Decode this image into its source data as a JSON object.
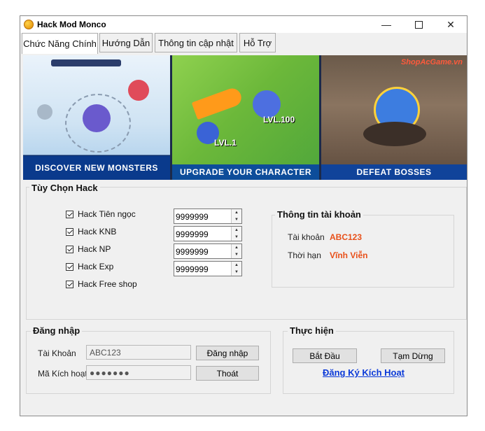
{
  "window": {
    "title": "Hack Mod Monco"
  },
  "tabs": [
    {
      "label": "Chức Năng Chính"
    },
    {
      "label": "Hướng Dẫn"
    },
    {
      "label": "Thông tin cập nhật"
    },
    {
      "label": "Hỗ Trợ"
    }
  ],
  "banner": {
    "captions": [
      "DISCOVER NEW MONSTERS",
      "UPGRADE YOUR CHARACTER",
      "DEFEAT BOSSES"
    ],
    "level_before": "LVL.1",
    "level_after": "LVL.100",
    "watermark": "ShopAcGame.vn"
  },
  "hack_options": {
    "title": "Tùy Chọn Hack",
    "items": [
      {
        "label": "Hack Tiên ngọc",
        "checked": true,
        "value": "9999999"
      },
      {
        "label": "Hack KNB",
        "checked": true,
        "value": "9999999"
      },
      {
        "label": "Hack NP",
        "checked": true,
        "value": "9999999"
      },
      {
        "label": "Hack Exp",
        "checked": true,
        "value": "9999999"
      },
      {
        "label": "Hack Free shop",
        "checked": true
      }
    ]
  },
  "account_info": {
    "title": "Thông tin tài khoản",
    "account_label": "Tài khoản",
    "account_value": "ABC123",
    "term_label": "Thời hạn",
    "term_value": "Vĩnh Viễn"
  },
  "login": {
    "title": "Đăng nhập",
    "account_label": "Tài Khoản",
    "account_value": "ABC123",
    "code_label": "Mã Kích hoạt",
    "code_value": "●●●●●●●",
    "login_button": "Đăng nhập",
    "exit_button": "Thoát"
  },
  "execute": {
    "title": "Thực hiện",
    "start_button": "Bắt Đầu",
    "pause_button": "Tạm Dừng",
    "register_link": "Đăng Ký Kích Hoạt"
  },
  "colors": {
    "accent_value": "#e8501a",
    "link": "#0a39d8"
  }
}
